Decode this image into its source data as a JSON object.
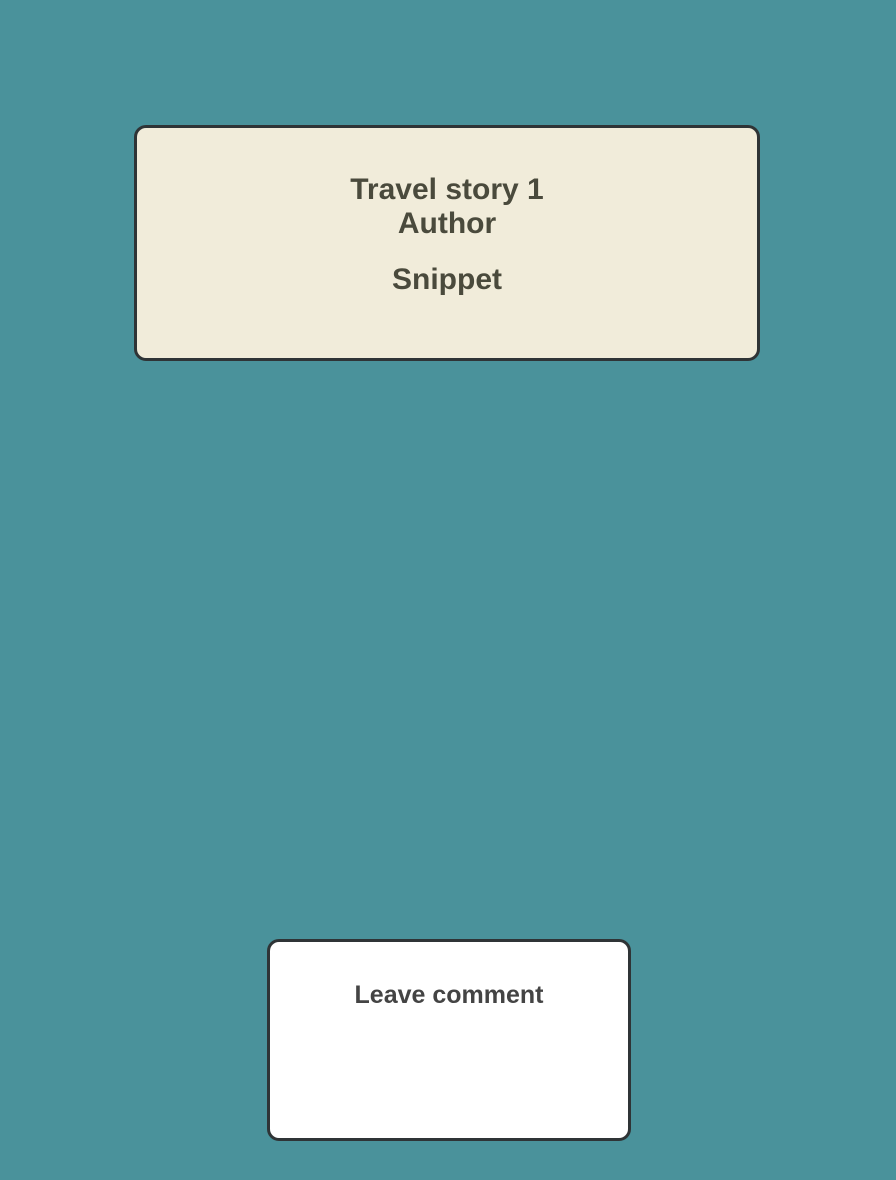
{
  "colors": {
    "background": "#4a929b",
    "card_background": "#f1ecda",
    "card_border": "#2f3436",
    "card_text": "#4a4a3c",
    "comment_background": "#ffffff",
    "comment_text": "#444444"
  },
  "story_card": {
    "title": "Travel story 1",
    "author": "Author",
    "snippet": "Snippet"
  },
  "comment_box": {
    "label": "Leave comment"
  }
}
